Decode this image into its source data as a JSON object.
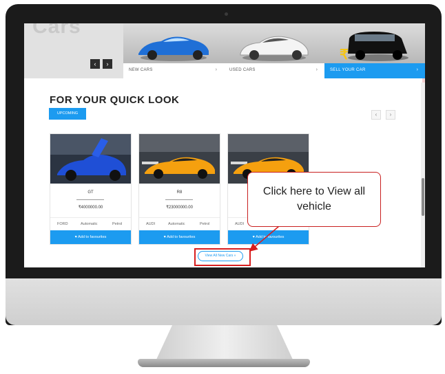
{
  "hero": {
    "title": "Cars",
    "prev_arrow": "‹",
    "next_arrow": "›",
    "tiles": [
      {
        "label": "NEW CARS",
        "chevron": "›",
        "car_color": "#1f6fd6"
      },
      {
        "label": "USED CARS",
        "chevron": "›",
        "car_color": "#f4f4f4"
      },
      {
        "label": "SELL YOUR CAR",
        "chevron": "›",
        "car_color": "#111111"
      }
    ]
  },
  "section": {
    "title": "FOR YOUR QUICK LOOK",
    "tab": "UPCOMING",
    "prev": "‹",
    "next": "›"
  },
  "cards": [
    {
      "name": "GT",
      "price": "₹4000000.00",
      "brand": "FORD",
      "transmission": "Automatic",
      "fuel": "Petrol",
      "button": "Add to favourites",
      "car_color": "#1f4fd6"
    },
    {
      "name": "R8",
      "price": "₹23000000.00",
      "brand": "AUDI",
      "transmission": "Automatic",
      "fuel": "Petrol",
      "button": "Add to favourites",
      "car_color": "#f5a00f"
    },
    {
      "name": "",
      "price": "",
      "brand": "AUDI",
      "transmission": "",
      "fuel": "",
      "button": "Add to favourites",
      "car_color": "#f5a00f"
    }
  ],
  "view_all": {
    "label": "View All New Cars »"
  },
  "callout": {
    "text": "Click here to View all vehicle"
  },
  "colors": {
    "accent": "#1c9bf0",
    "highlight": "#d81d1d"
  }
}
